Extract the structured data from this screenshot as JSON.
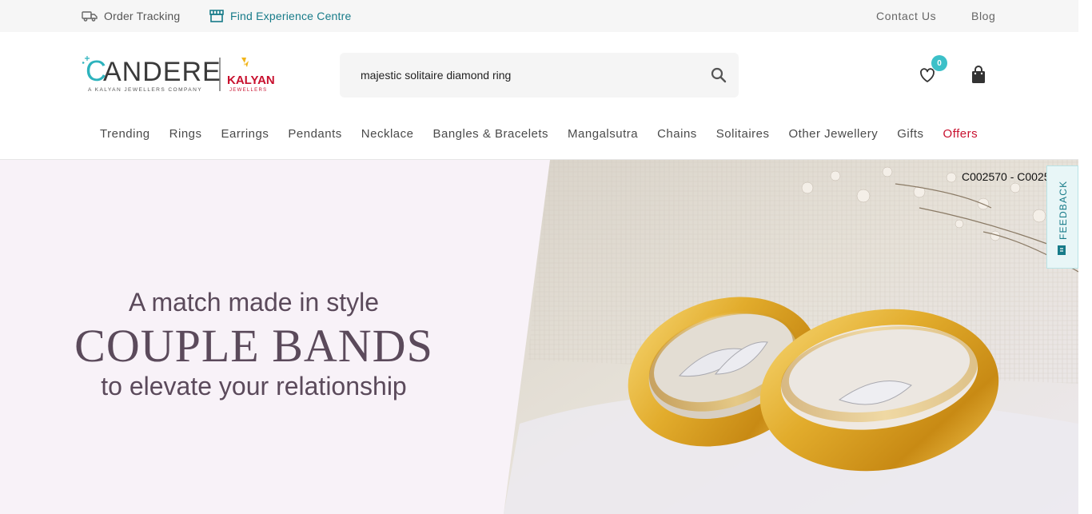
{
  "topbar": {
    "order_tracking": "Order Tracking",
    "find_experience_centre": "Find Experience Centre",
    "contact_us": "Contact Us",
    "blog": "Blog"
  },
  "logo": {
    "brand": "CANDERE",
    "tagline": "A KALYAN JEWELLERS COMPANY",
    "partner": "KALYAN",
    "partner_sub": "JEWELLERS"
  },
  "search": {
    "value": "majestic solitaire diamond ring",
    "icon": "search-icon"
  },
  "wishlist": {
    "count": "0",
    "icon": "heart-icon"
  },
  "cart": {
    "icon": "shopping-bag-icon"
  },
  "nav": {
    "items": [
      {
        "label": "Trending"
      },
      {
        "label": "Rings"
      },
      {
        "label": "Earrings"
      },
      {
        "label": "Pendants"
      },
      {
        "label": "Necklace"
      },
      {
        "label": "Bangles & Bracelets"
      },
      {
        "label": "Mangalsutra"
      },
      {
        "label": "Chains"
      },
      {
        "label": "Solitaires"
      },
      {
        "label": "Other Jewellery"
      },
      {
        "label": "Gifts"
      },
      {
        "label": "Offers"
      }
    ]
  },
  "hero": {
    "line1": "A match made in style",
    "line2": "COUPLE BANDS",
    "line3": "to elevate your relationship",
    "product_code": "C002570 - C0025"
  },
  "feedback": {
    "label": "FEEDBACK"
  },
  "colors": {
    "accent": "#177b89",
    "badge": "#3cc0c8",
    "offer": "#c8102e",
    "hero_bg": "#f8f2f8",
    "hero_text": "#5b4a5b"
  }
}
